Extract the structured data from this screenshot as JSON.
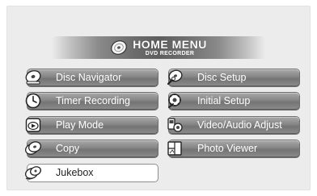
{
  "header": {
    "title": "HOME MENU",
    "subtitle": "DVD RECORDER",
    "logo_icon": "disc-icon"
  },
  "menu": {
    "left": [
      {
        "label": "Disc Navigator",
        "icon": "disc-navigator-icon",
        "selected": false
      },
      {
        "label": "Timer Recording",
        "icon": "clock-icon",
        "selected": false
      },
      {
        "label": "Play Mode",
        "icon": "play-mode-icon",
        "selected": false
      },
      {
        "label": "Copy",
        "icon": "copy-disc-icon",
        "selected": false
      },
      {
        "label": "Jukebox",
        "icon": "jukebox-icon",
        "selected": true
      }
    ],
    "right": [
      {
        "label": "Disc Setup",
        "icon": "disc-setup-icon",
        "selected": false
      },
      {
        "label": "Initial Setup",
        "icon": "initial-setup-icon",
        "selected": false
      },
      {
        "label": "Video/Audio Adjust",
        "icon": "video-audio-adjust-icon",
        "selected": false
      },
      {
        "label": "Photo Viewer",
        "icon": "photo-viewer-icon",
        "selected": false
      }
    ]
  },
  "colors": {
    "button": "#858585",
    "button_selected": "#ffffff",
    "label": "#ffffff",
    "label_selected": "#222222",
    "screen_bg": "#ececec"
  }
}
